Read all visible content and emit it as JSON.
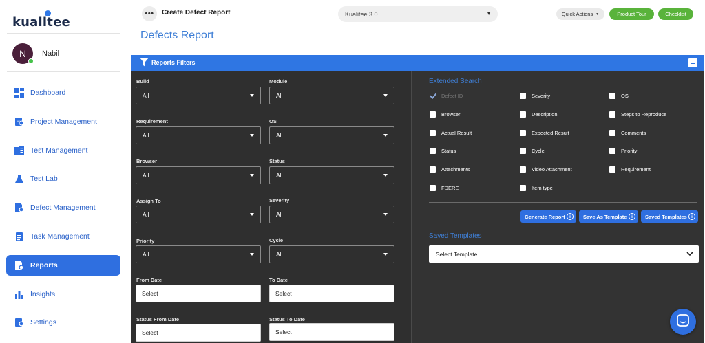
{
  "brand": {
    "logo_text": "kualitee"
  },
  "user": {
    "initial": "N",
    "name": "Nabil"
  },
  "sidebar": {
    "items": [
      {
        "label": "Dashboard",
        "icon": "dashboard-icon"
      },
      {
        "label": "Project Management",
        "icon": "project-management-icon"
      },
      {
        "label": "Test Management",
        "icon": "test-management-icon"
      },
      {
        "label": "Test Lab",
        "icon": "flask-icon"
      },
      {
        "label": "Defect Management",
        "icon": "defect-management-icon"
      },
      {
        "label": "Task Management",
        "icon": "task-management-icon"
      },
      {
        "label": "Reports",
        "icon": "reports-icon",
        "active": true
      },
      {
        "label": "Insights",
        "icon": "insights-icon"
      },
      {
        "label": "Settings",
        "icon": "settings-icon"
      }
    ]
  },
  "topbar": {
    "more_label": "•••",
    "page_heading": "Create Defect Report",
    "project": "Kualitee 3.0",
    "quick_actions": "Quick Actions",
    "product_tour": "Product Tour",
    "checklist": "Checklist"
  },
  "page": {
    "title": "Defects Report"
  },
  "filters": {
    "header": "Reports Filters",
    "fields": {
      "build": {
        "label": "Build",
        "value": "All"
      },
      "module": {
        "label": "Module",
        "value": "All"
      },
      "requirement": {
        "label": "Requirement",
        "value": "All"
      },
      "os": {
        "label": "OS",
        "value": "All"
      },
      "browser": {
        "label": "Browser",
        "value": "All"
      },
      "status": {
        "label": "Status",
        "value": "All"
      },
      "assign_to": {
        "label": "Assign To",
        "value": "All"
      },
      "severity": {
        "label": "Severity",
        "value": "All"
      },
      "priority": {
        "label": "Priority",
        "value": "All"
      },
      "cycle": {
        "label": "Cycle",
        "value": "All"
      },
      "from_date": {
        "label": "From Date",
        "value": "Select"
      },
      "to_date": {
        "label": "To Date",
        "value": "Select"
      },
      "status_from_date": {
        "label": "Status From Date",
        "value": "Select"
      },
      "status_to_date": {
        "label": "Status To Date",
        "value": "Select"
      }
    }
  },
  "extended": {
    "title": "Extended Search",
    "checkboxes": [
      {
        "label": "Defect ID",
        "checked": true,
        "disabled": true
      },
      {
        "label": "Severity"
      },
      {
        "label": "OS"
      },
      {
        "label": "Browser"
      },
      {
        "label": "Description"
      },
      {
        "label": "Steps to Reproduce"
      },
      {
        "label": "Actual Result"
      },
      {
        "label": "Expected Result"
      },
      {
        "label": "Comments"
      },
      {
        "label": "Status"
      },
      {
        "label": "Cycle"
      },
      {
        "label": "Priority"
      },
      {
        "label": "Attachments"
      },
      {
        "label": "Video Attachment"
      },
      {
        "label": "Requirement"
      },
      {
        "label": "FDERE"
      },
      {
        "label": "Item type"
      }
    ],
    "buttons": {
      "generate": "Generate Report",
      "save_template": "Save As Template",
      "saved_templates": "Saved Templates",
      "info": "i"
    },
    "saved_title": "Saved Templates",
    "template_placeholder": "Select Template"
  },
  "colors": {
    "accent": "#2f76e3",
    "active_nav": "#2f6fe0",
    "green": "#59b33b",
    "panel_dark": "#2f2f2f",
    "title_blue": "#3f7fd6"
  }
}
